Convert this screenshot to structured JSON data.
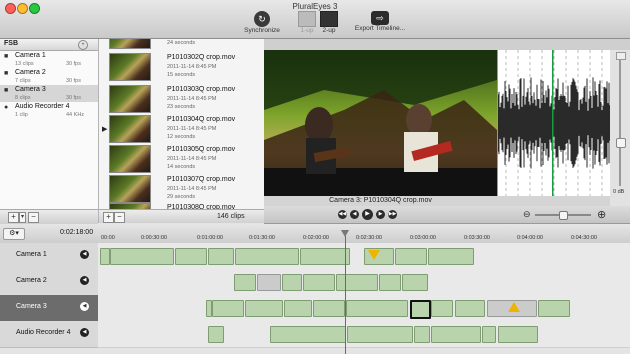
{
  "window": {
    "title": "PluralEyes 3"
  },
  "toolbar": {
    "synchronize": "Synchronize",
    "view_1up": "1-up",
    "view_2up": "2-up",
    "export": "Export Timeline..."
  },
  "media_panel": {
    "tab": "FSB",
    "items": [
      {
        "name": "Camera 1",
        "clips": "13 clips",
        "fps": "30 fps"
      },
      {
        "name": "Camera 2",
        "clips": "7 clips",
        "fps": "30 fps"
      },
      {
        "name": "Camera 3",
        "clips": "8 clips",
        "fps": "30 fps"
      },
      {
        "name": "Audio Recorder 4",
        "clips": "1 clip",
        "fps": "44 KHz"
      }
    ]
  },
  "clip_list": {
    "clips": [
      {
        "name": "",
        "date": "",
        "duration": "24 seconds"
      },
      {
        "name": "P1010302Q crop.mov",
        "date": "2011-11-14 8:45 PM",
        "duration": "15 seconds"
      },
      {
        "name": "P1010303Q crop.mov",
        "date": "2011-11-14 8:45 PM",
        "duration": "23 seconds"
      },
      {
        "name": "P1010304Q crop.mov",
        "date": "2011-11-14 8:45 PM",
        "duration": "12 seconds"
      },
      {
        "name": "P1010305Q crop.mov",
        "date": "2011-11-14 8:45 PM",
        "duration": "14 seconds"
      },
      {
        "name": "P1010307Q crop.mov",
        "date": "2011-11-14 8:45 PM",
        "duration": "29 seconds"
      },
      {
        "name": "P1010308Q crop.mov",
        "date": "",
        "duration": ""
      }
    ],
    "count": "146 clips"
  },
  "viewer": {
    "label": "Camera 3: P1010304Q crop.mov"
  },
  "waveform": {
    "db_label": "0 dB"
  },
  "timeline": {
    "timecode": "0:02:18:00",
    "ticks": [
      "00:00",
      "0:00:30:00",
      "0:01:00:00",
      "0:01:30:00",
      "0:02:00:00",
      "0:02:30:00",
      "0:03:00:00",
      "0:03:30:00",
      "0:04:00:00",
      "0:04:30:00"
    ],
    "tracks": [
      {
        "name": "Camera 1"
      },
      {
        "name": "Camera 2"
      },
      {
        "name": "Camera 3"
      },
      {
        "name": "Audio Recorder 4"
      }
    ]
  },
  "colors": {
    "clip_green": "#b9d3ad",
    "playhead": "#1a9a45",
    "warning": "#f0b400",
    "selected_track": "#6c6c6c"
  }
}
